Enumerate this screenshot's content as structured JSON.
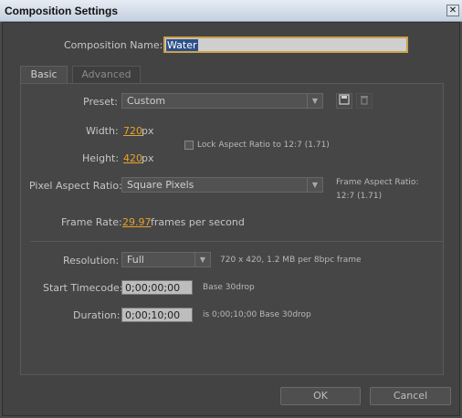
{
  "window": {
    "title": "Composition Settings",
    "close_glyph": "✕"
  },
  "composition_name": {
    "label": "Composition Name:",
    "value": "Water"
  },
  "tabs": [
    {
      "label": "Basic"
    },
    {
      "label": "Advanced"
    }
  ],
  "preset": {
    "label": "Preset:",
    "value": "Custom",
    "save_icon": "save-preset-icon",
    "delete_icon": "delete-preset-icon"
  },
  "width": {
    "label": "Width:",
    "value": "720",
    "unit": "px"
  },
  "height": {
    "label": "Height:",
    "value": "420",
    "unit": "px"
  },
  "lock_aspect": {
    "label": "Lock Aspect Ratio to 12:7 (1.71)",
    "checked": false
  },
  "pixel_aspect": {
    "label": "Pixel Aspect Ratio:",
    "value": "Square Pixels"
  },
  "frame_aspect": {
    "line1": "Frame Aspect Ratio:",
    "line2": "12:7 (1.71)"
  },
  "frame_rate": {
    "label": "Frame Rate:",
    "value": "29.97",
    "unit": "frames per second"
  },
  "resolution": {
    "label": "Resolution:",
    "value": "Full",
    "info": "720 x 420, 1.2 MB per 8bpc frame"
  },
  "start_timecode": {
    "label": "Start Timecode:",
    "value": "0;00;00;00",
    "info": "Base 30drop"
  },
  "duration": {
    "label": "Duration:",
    "value": "0;00;10;00",
    "info": "is 0;00;10;00  Base 30drop"
  },
  "buttons": {
    "ok": "OK",
    "cancel": "Cancel"
  }
}
